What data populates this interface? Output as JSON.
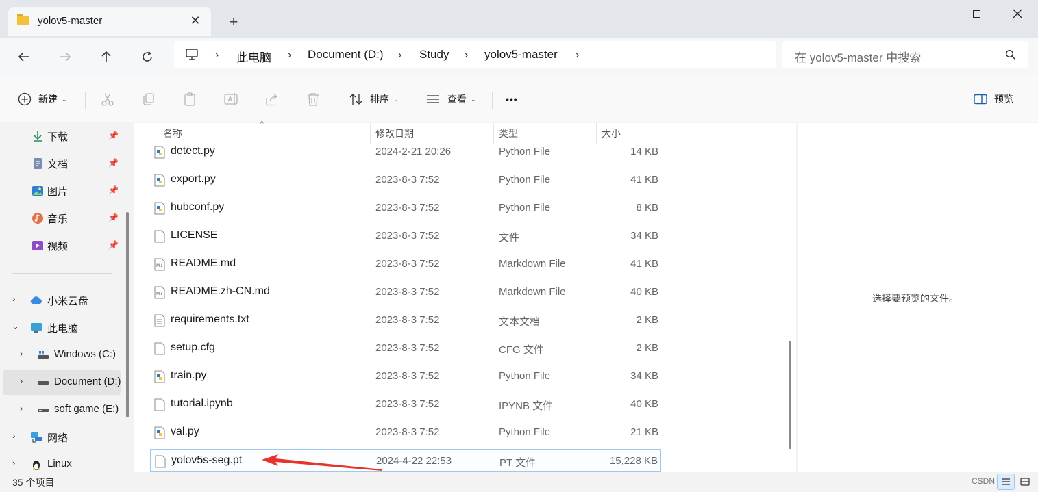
{
  "tab": {
    "title": "yolov5-master"
  },
  "address": {
    "crumbs": [
      "此电脑",
      "Document (D:)",
      "Study",
      "yolov5-master"
    ]
  },
  "search": {
    "placeholder": "在 yolov5-master 中搜索"
  },
  "toolbar": {
    "new_label": "新建",
    "sort_label": "排序",
    "view_label": "查看",
    "more_label": "•••",
    "preview_label": "预览"
  },
  "sidebar": {
    "quick": [
      {
        "label": "下载",
        "icon": "download-icon"
      },
      {
        "label": "文档",
        "icon": "document-icon"
      },
      {
        "label": "图片",
        "icon": "pictures-icon"
      },
      {
        "label": "音乐",
        "icon": "music-icon"
      },
      {
        "label": "视频",
        "icon": "video-icon"
      }
    ],
    "tree": [
      {
        "label": "小米云盘",
        "icon": "cloud-icon"
      },
      {
        "label": "此电脑",
        "icon": "computer-icon"
      },
      {
        "label": "Windows (C:)",
        "icon": "drive-icon"
      },
      {
        "label": "Document (D:)",
        "icon": "drive-icon"
      },
      {
        "label": "soft game (E:)",
        "icon": "drive-icon"
      },
      {
        "label": "网络",
        "icon": "network-icon"
      },
      {
        "label": "Linux",
        "icon": "linux-icon"
      }
    ]
  },
  "columns": {
    "name": "名称",
    "date": "修改日期",
    "type": "类型",
    "size": "大小"
  },
  "files": [
    {
      "name": "detect.py",
      "date": "2024-2-21 20:26",
      "type": "Python File",
      "size": "14 KB",
      "icon": "python-file-icon"
    },
    {
      "name": "export.py",
      "date": "2023-8-3 7:52",
      "type": "Python File",
      "size": "41 KB",
      "icon": "python-file-icon"
    },
    {
      "name": "hubconf.py",
      "date": "2023-8-3 7:52",
      "type": "Python File",
      "size": "8 KB",
      "icon": "python-file-icon"
    },
    {
      "name": "LICENSE",
      "date": "2023-8-3 7:52",
      "type": "文件",
      "size": "34 KB",
      "icon": "file-icon"
    },
    {
      "name": "README.md",
      "date": "2023-8-3 7:52",
      "type": "Markdown File",
      "size": "41 KB",
      "icon": "markdown-file-icon"
    },
    {
      "name": "README.zh-CN.md",
      "date": "2023-8-3 7:52",
      "type": "Markdown File",
      "size": "40 KB",
      "icon": "markdown-file-icon"
    },
    {
      "name": "requirements.txt",
      "date": "2023-8-3 7:52",
      "type": "文本文档",
      "size": "2 KB",
      "icon": "text-file-icon"
    },
    {
      "name": "setup.cfg",
      "date": "2023-8-3 7:52",
      "type": "CFG 文件",
      "size": "2 KB",
      "icon": "file-icon"
    },
    {
      "name": "train.py",
      "date": "2023-8-3 7:52",
      "type": "Python File",
      "size": "34 KB",
      "icon": "python-file-icon"
    },
    {
      "name": "tutorial.ipynb",
      "date": "2023-8-3 7:52",
      "type": "IPYNB 文件",
      "size": "40 KB",
      "icon": "file-icon"
    },
    {
      "name": "val.py",
      "date": "2023-8-3 7:52",
      "type": "Python File",
      "size": "21 KB",
      "icon": "python-file-icon"
    },
    {
      "name": "yolov5s-seg.pt",
      "date": "2024-4-22 22:53",
      "type": "PT 文件",
      "size": "15,228 KB",
      "icon": "file-icon"
    }
  ],
  "preview": {
    "message": "选择要预览的文件。"
  },
  "status": {
    "count": "35 个项目",
    "watermark": "CSDN @"
  }
}
